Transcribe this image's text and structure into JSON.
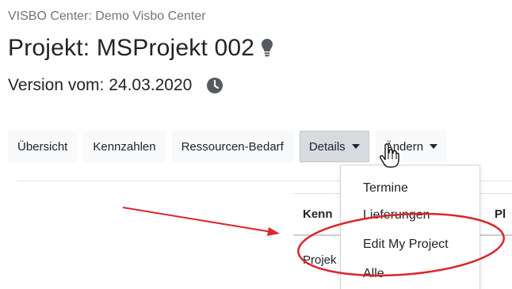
{
  "header": {
    "center_label": "VISBO Center: Demo Visbo Center",
    "project_title": "Projekt: MSProjekt 002",
    "version_label": "Version vom: 24.03.2020"
  },
  "tabs": [
    {
      "label": "Übersicht"
    },
    {
      "label": "Kennzahlen"
    },
    {
      "label": "Ressourcen-Bedarf"
    },
    {
      "label": "Details",
      "active": true
    },
    {
      "label": "Ändern"
    }
  ],
  "table": {
    "headers": [
      "Kenn",
      "Pl"
    ],
    "first_cell": "Projek"
  },
  "dropdown": {
    "items": [
      "Termine",
      "Lieferungen",
      "Edit My Project",
      "Alle"
    ]
  },
  "icons": {
    "bulb": "lightbulb-icon",
    "clock": "clock-icon",
    "cursor": "hand-pointer-cursor-icon"
  },
  "colors": {
    "annotation": "#d9262c",
    "active_tab": "#d6dbe0",
    "tab_bg": "#f8f9fa",
    "muted_text": "#6c757d"
  }
}
